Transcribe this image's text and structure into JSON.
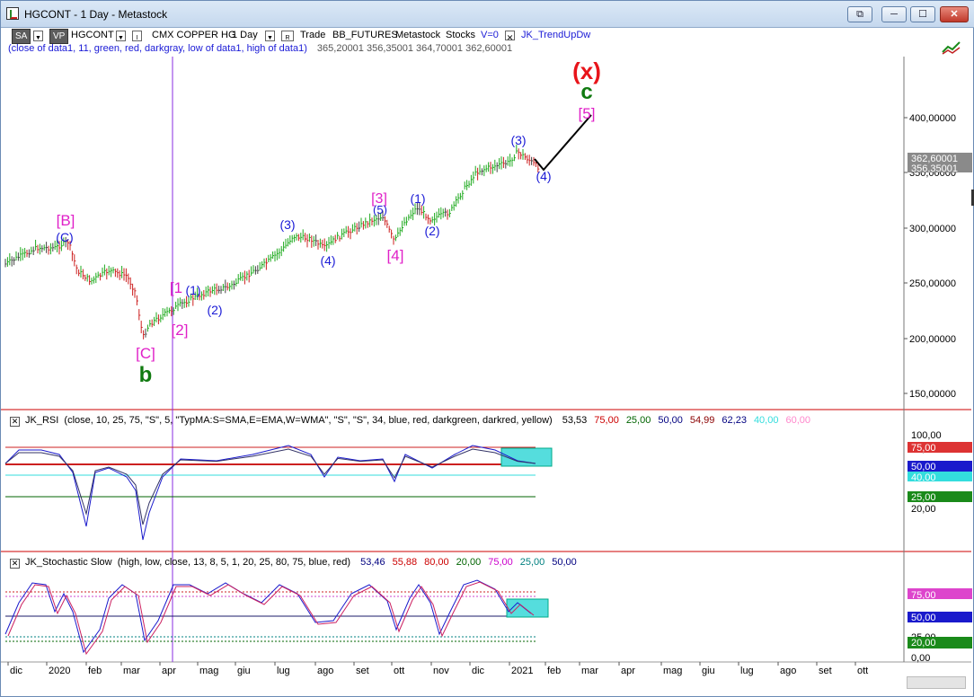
{
  "window": {
    "title": "HGCONT - 1 Day - Metastock",
    "buttons": {
      "restore": "⧉",
      "minimize": "─",
      "maximize": "☐",
      "close": "✕"
    }
  },
  "toolbar": {
    "sa": "SA",
    "vp": "VP",
    "symbol": "HGCONT",
    "i_label": "I",
    "instrument": "CMX COPPER HG",
    "interval": "1 Day",
    "r_label": "R",
    "session": "Trade",
    "data_source": "BB_FUTURES",
    "provider": "Metastock",
    "category": "Stocks",
    "volume": "V=0",
    "indicator": "JK_TrendUpDw",
    "drop_glyph": "▼",
    "check_glyph": "✕"
  },
  "trend_params": {
    "text": "(close of data1,  11,  green,  red,  darkgray,  low of data1,  high of data1)",
    "values": "365,20001  356,35001  364,70001  362,60001"
  },
  "price_axis": {
    "ticks": [
      "400,00000",
      "350,00000",
      "300,00000",
      "250,00000",
      "200,00000",
      "150,00000"
    ],
    "last_price": "362,60001",
    "prev_price": "356,35001"
  },
  "wave_labels": [
    {
      "text": "(x)",
      "color": "#e8141a"
    },
    {
      "text": "c",
      "color": "#107a10"
    },
    {
      "text": "[5]",
      "color": "#e020c8"
    },
    {
      "text": "(3)",
      "color": "#1a1ad6"
    },
    {
      "text": "(4)",
      "color": "#1a1ad6"
    },
    {
      "text": "[3]",
      "color": "#e020c8"
    },
    {
      "text": "(5)",
      "color": "#1a1ad6"
    },
    {
      "text": "(1)",
      "color": "#1a1ad6"
    },
    {
      "text": "(2)",
      "color": "#1a1ad6"
    },
    {
      "text": "(3)",
      "color": "#1a1ad6"
    },
    {
      "text": "(4)",
      "color": "#1a1ad6"
    },
    {
      "text": "[4]",
      "color": "#e020c8"
    },
    {
      "text": "[B]",
      "color": "#e020c8"
    },
    {
      "text": "(C)",
      "color": "#1a1ad6"
    },
    {
      "text": "[1",
      "color": "#e020c8"
    },
    {
      "text": "(1)",
      "color": "#1a1ad6"
    },
    {
      "text": "(2)",
      "color": "#1a1ad6"
    },
    {
      "text": "[2]",
      "color": "#e020c8"
    },
    {
      "text": "[C]",
      "color": "#e020c8"
    },
    {
      "text": "b",
      "color": "#107a10"
    }
  ],
  "rsi": {
    "name": "JK_RSI",
    "params": "(close,  10,  25,  75,  \"S\",  5,  \"TypMA:S=SMA,E=EMA,W=WMA\",  \"S\",  \"S\",  34,  blue,  red,  darkgreen,  darkred,  yellow)",
    "values": [
      {
        "text": "53,53",
        "color": "#000000"
      },
      {
        "text": "75,00",
        "color": "#cc0000"
      },
      {
        "text": "25,00",
        "color": "#006400"
      },
      {
        "text": "50,00",
        "color": "#000080"
      },
      {
        "text": "54,99",
        "color": "#8b0000"
      },
      {
        "text": "62,23",
        "color": "#000080"
      },
      {
        "text": "40,00",
        "color": "#33dddd"
      },
      {
        "text": "60,00",
        "color": "#ff88cc"
      }
    ],
    "axis": [
      "100,00",
      "75,00",
      "50,00",
      "40,00",
      "25,00",
      "20,00"
    ]
  },
  "stoch": {
    "name": "JK_Stochastic Slow",
    "params": "(high,  low,  close,  13,  8,  5,  1,  20,  25,  80,  75,  blue,  red)",
    "values": [
      {
        "text": "53,46",
        "color": "#000080"
      },
      {
        "text": "55,88",
        "color": "#cc0000"
      },
      {
        "text": "80,00",
        "color": "#cc0000"
      },
      {
        "text": "20,00",
        "color": "#006400"
      },
      {
        "text": "75,00",
        "color": "#cc00cc"
      },
      {
        "text": "25,00",
        "color": "#008080"
      },
      {
        "text": "50,00",
        "color": "#000080"
      }
    ],
    "axis": [
      "75,00",
      "50,00",
      "25,00",
      "20,00",
      "0,00"
    ]
  },
  "time_axis": [
    "dic",
    "2020",
    "feb",
    "mar",
    "apr",
    "mag",
    "giu",
    "lug",
    "ago",
    "set",
    "ott",
    "nov",
    "dic",
    "2021",
    "feb",
    "mar",
    "apr",
    "mag",
    "giu",
    "lug",
    "ago",
    "set",
    "ott"
  ],
  "colors": {
    "up": "#1faa1f",
    "down": "#cc2020",
    "neutral": "#444444",
    "cursor": "#8a2be2",
    "axis_sep": "#cc0000"
  }
}
